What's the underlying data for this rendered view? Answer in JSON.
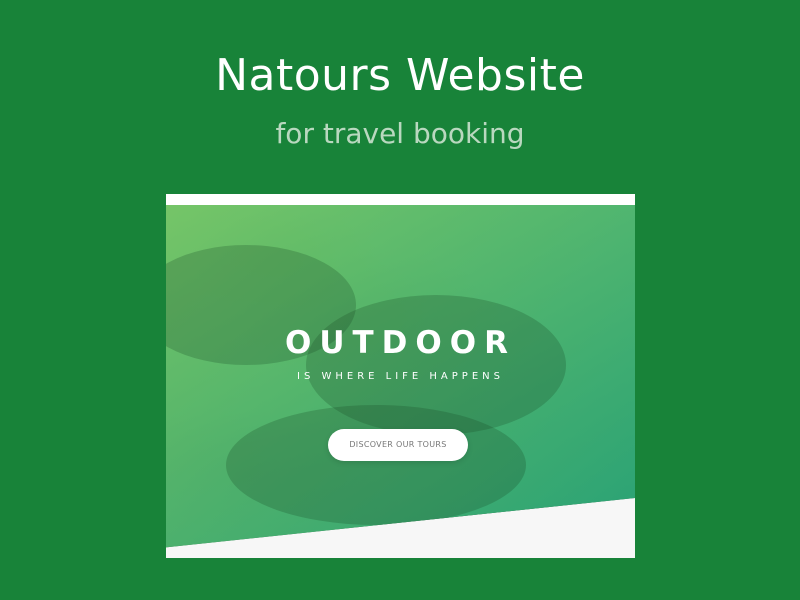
{
  "page": {
    "title": "Natours Website",
    "subtitle": "for travel booking"
  },
  "preview": {
    "hero_heading": "OUTDOOR",
    "hero_subheading": "IS WHERE LIFE HAPPENS",
    "cta_label": "DISCOVER OUR TOURS"
  },
  "colors": {
    "background": "#188339",
    "gradient_light": "#7ed56f",
    "gradient_dark": "#28b485",
    "button_background": "#ffffff"
  }
}
